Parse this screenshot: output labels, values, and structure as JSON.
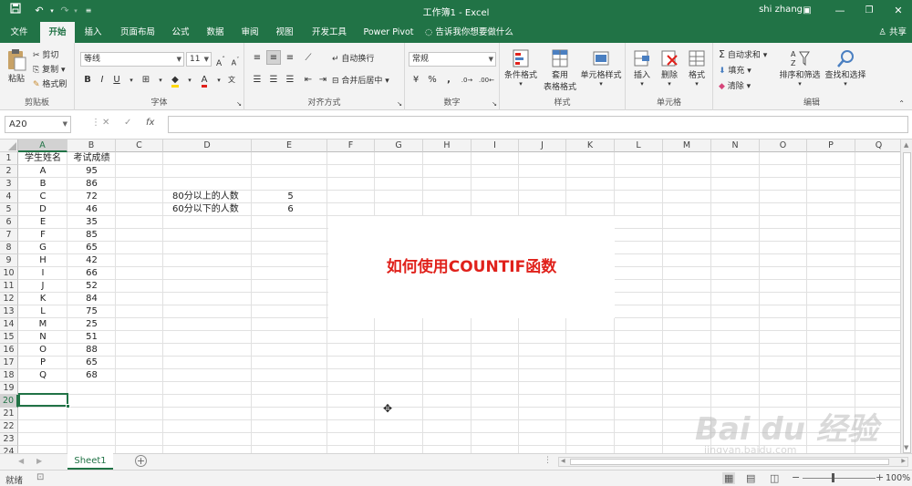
{
  "window": {
    "doc_title": "工作簿1  -  Excel",
    "user": "shi zhang"
  },
  "tabs": [
    {
      "label": "文件",
      "active": false
    },
    {
      "label": "开始",
      "active": true
    },
    {
      "label": "插入",
      "active": false
    },
    {
      "label": "页面布局",
      "active": false
    },
    {
      "label": "公式",
      "active": false
    },
    {
      "label": "数据",
      "active": false
    },
    {
      "label": "审阅",
      "active": false
    },
    {
      "label": "视图",
      "active": false
    },
    {
      "label": "开发工具",
      "active": false
    },
    {
      "label": "Power Pivot",
      "active": false
    }
  ],
  "tell_me": "告诉我你想要做什么",
  "share": "共享",
  "ribbon": {
    "clipboard": {
      "paste": "粘贴",
      "cut": "剪切",
      "copy": "复制",
      "format_painter": "格式刷",
      "label": "剪贴板"
    },
    "font": {
      "name": "等线",
      "size": "11",
      "bold": "B",
      "italic": "I",
      "underline": "U",
      "label": "字体"
    },
    "align": {
      "wrap": "自动换行",
      "merge": "合并后居中",
      "label": "对齐方式"
    },
    "number": {
      "format": "常规",
      "label": "数字"
    },
    "styles": {
      "conditional": "条件格式",
      "table_line1": "套用",
      "table_line2": "表格格式",
      "cell_styles": "单元格样式",
      "label": "样式"
    },
    "cells": {
      "insert": "插入",
      "delete": "删除",
      "format": "格式",
      "label": "单元格"
    },
    "editing": {
      "autosum": "自动求和",
      "fill": "填充",
      "clear": "清除",
      "sort": "排序和筛选",
      "find": "查找和选择",
      "label": "编辑"
    }
  },
  "formula_bar": {
    "name_box": "A20",
    "fx": "fx",
    "content": ""
  },
  "grid": {
    "columns": [
      "A",
      "B",
      "C",
      "D",
      "E",
      "F",
      "G",
      "H",
      "I",
      "J",
      "K",
      "L",
      "M",
      "N",
      "O",
      "P",
      "Q"
    ],
    "selected_column": "A",
    "rows": [
      "1",
      "2",
      "3",
      "4",
      "5",
      "6",
      "7",
      "8",
      "9",
      "10",
      "11",
      "12",
      "13",
      "14",
      "15",
      "16",
      "17",
      "18",
      "19",
      "20",
      "21",
      "22",
      "23",
      "24"
    ],
    "selected_row": "20",
    "headers": {
      "name": "学生姓名",
      "score": "考试成绩"
    },
    "students": [
      {
        "name": "A",
        "score": "95"
      },
      {
        "name": "B",
        "score": "86"
      },
      {
        "name": "C",
        "score": "72"
      },
      {
        "name": "D",
        "score": "46"
      },
      {
        "name": "E",
        "score": "35"
      },
      {
        "name": "F",
        "score": "85"
      },
      {
        "name": "G",
        "score": "65"
      },
      {
        "name": "H",
        "score": "42"
      },
      {
        "name": "I",
        "score": "66"
      },
      {
        "name": "J",
        "score": "52"
      },
      {
        "name": "K",
        "score": "84"
      },
      {
        "name": "L",
        "score": "75"
      },
      {
        "name": "M",
        "score": "25"
      },
      {
        "name": "N",
        "score": "51"
      },
      {
        "name": "O",
        "score": "88"
      },
      {
        "name": "P",
        "score": "65"
      },
      {
        "name": "Q",
        "score": "68"
      }
    ],
    "summary": [
      {
        "label": "80分以上的人数",
        "value": "5"
      },
      {
        "label": "60分以下的人数",
        "value": "6"
      }
    ]
  },
  "textbox": "如何使用COUNTIF函数",
  "sheet_tab": "Sheet1",
  "status": {
    "ready": "就绪",
    "zoom": "100%"
  },
  "watermark": {
    "brand": "Bai du 经验",
    "url": "jingyan.baidu.com"
  },
  "colors": {
    "excel_green": "#217346",
    "textbox_red": "#e0211b"
  }
}
